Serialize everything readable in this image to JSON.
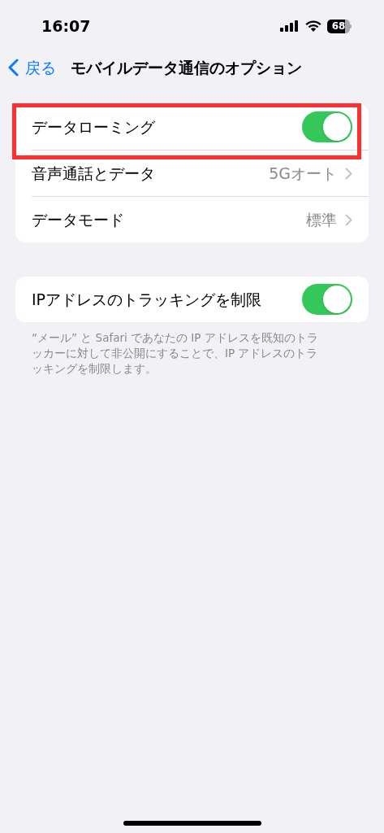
{
  "status_bar": {
    "time": "16:07",
    "battery": "68"
  },
  "nav": {
    "back": "戻る",
    "title": "モバイルデータ通信のオプション"
  },
  "groups": [
    {
      "rows": [
        {
          "kind": "toggle",
          "label": "データローミング",
          "on": true,
          "highlighted": true
        },
        {
          "kind": "link",
          "label": "音声通話とデータ",
          "value": "5Gオート",
          "highlighted": false
        },
        {
          "kind": "link",
          "label": "データモード",
          "value": "標準",
          "highlighted": false
        }
      ]
    },
    {
      "rows": [
        {
          "kind": "toggle",
          "label": "IPアドレスのトラッキングを制限",
          "on": true,
          "highlighted": false
        }
      ],
      "footer": "“メール” と Safari であなたの IP アドレスを既知のトラッカーに対して非公開にすることで、IP アドレスのトラッキングを制限します。"
    }
  ]
}
